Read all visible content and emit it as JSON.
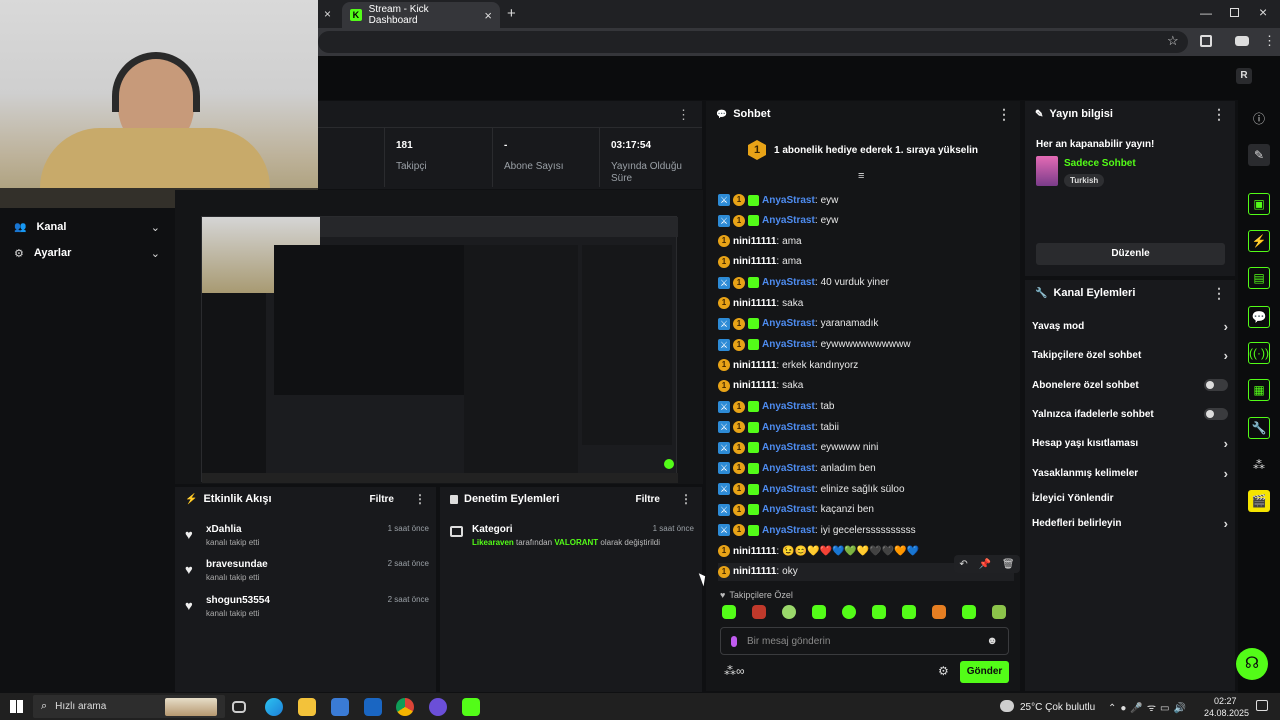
{
  "browser": {
    "tab_title": "Stream - Kick Dashboard",
    "tab_close": "×",
    "new_tab": "+"
  },
  "sidebar": {
    "items": [
      {
        "label": "Kanal",
        "icon": "people-icon"
      },
      {
        "label": "Ayarlar",
        "icon": "gear-icon"
      }
    ]
  },
  "stats": [
    {
      "value": "181",
      "label": "Takipçi"
    },
    {
      "value": "-",
      "label": "Abone Sayısı"
    },
    {
      "value": "03:17:54",
      "label": "Yayında Olduğu Süre"
    }
  ],
  "events": {
    "title": "Etkinlik Akışı",
    "filter": "Filtre",
    "items": [
      {
        "name": "xDahlia",
        "action": "kanalı takip etti",
        "time": "1 saat önce"
      },
      {
        "name": "bravesundae",
        "action": "kanalı takip etti",
        "time": "2 saat önce"
      },
      {
        "name": "shogun53554",
        "action": "kanalı takip etti",
        "time": "2 saat önce"
      }
    ]
  },
  "moderation": {
    "title": "Denetim Eylemleri",
    "filter": "Filtre",
    "item": {
      "title": "Kategori",
      "user": "Likearaven",
      "middle": "tarafından",
      "category": "VALORANT",
      "end": "olarak değiştirildi",
      "time": "1 saat önce"
    }
  },
  "chat": {
    "title": "Sohbet",
    "pinned": "1 abonelik hediye ederek 1. sıraya yükselin",
    "pinned_rank": "1",
    "messages": [
      {
        "user": "AnyaStrast",
        "text": "eyw",
        "mod": true
      },
      {
        "user": "AnyaStrast",
        "text": "eyw",
        "mod": true
      },
      {
        "user": "nini11111",
        "text": "ama",
        "mod": false
      },
      {
        "user": "nini11111",
        "text": "ama",
        "mod": false
      },
      {
        "user": "AnyaStrast",
        "text": "40 vurduk yiner",
        "mod": true
      },
      {
        "user": "nini11111",
        "text": "saka",
        "mod": false
      },
      {
        "user": "AnyaStrast",
        "text": "yaranamadık",
        "mod": true
      },
      {
        "user": "AnyaStrast",
        "text": "eywwwwwwwwwww",
        "mod": true
      },
      {
        "user": "nini11111",
        "text": "erkek kandınyorz",
        "mod": false
      },
      {
        "user": "nini11111",
        "text": "saka",
        "mod": false
      },
      {
        "user": "AnyaStrast",
        "text": "tab",
        "mod": true
      },
      {
        "user": "AnyaStrast",
        "text": "tabii",
        "mod": true
      },
      {
        "user": "AnyaStrast",
        "text": "eywwww nini",
        "mod": true
      },
      {
        "user": "AnyaStrast",
        "text": "anladım ben",
        "mod": true
      },
      {
        "user": "AnyaStrast",
        "text": "elinize sağlık süloo",
        "mod": true
      },
      {
        "user": "AnyaStrast",
        "text": "kaçanzi ben",
        "mod": true
      },
      {
        "user": "AnyaStrast",
        "text": "iyi gecelerssssssssss",
        "mod": true
      },
      {
        "user": "nini11111",
        "text": "😉😊💛❤️💙💚💛🖤🖤🧡💙",
        "mod": false
      },
      {
        "user": "nini11111",
        "text": "oky",
        "mod": false
      }
    ],
    "followers_only": "Takipçilere Özel",
    "input_placeholder": "Bir mesaj gönderin",
    "send": "Gönder"
  },
  "stream_info": {
    "title": "Yayın bilgisi",
    "stream_title": "Her an kapanabilir yayın!",
    "category": "Sadece Sohbet",
    "language": "Turkish",
    "edit": "Düzenle"
  },
  "channel_actions": {
    "title": "Kanal Eylemleri",
    "items": [
      {
        "label": "Yavaş mod",
        "control": "chevron"
      },
      {
        "label": "Takipçilere özel sohbet",
        "control": "chevron"
      },
      {
        "label": "Abonelere özel sohbet",
        "control": "toggle"
      },
      {
        "label": "Yalnızca ifadelerle sohbet",
        "control": "toggle"
      },
      {
        "label": "Hesap yaşı kısıtlaması",
        "control": "chevron"
      },
      {
        "label": "Yasaklanmış kelimeler",
        "control": "chevron"
      },
      {
        "label": "İzleyici Yönlendir",
        "control": "none"
      },
      {
        "label": "Hedefleri belirleyin",
        "control": "chevron"
      }
    ]
  },
  "taskbar": {
    "search": "Hızlı arama",
    "weather": "25°C  Çok bulutlu",
    "time": "02:27",
    "date": "24.08.2025"
  },
  "colors": {
    "accent": "#53fc18",
    "mod_badge": "#2d8bd6",
    "username_blue": "#4e8cf0",
    "panel": "#18191c"
  }
}
